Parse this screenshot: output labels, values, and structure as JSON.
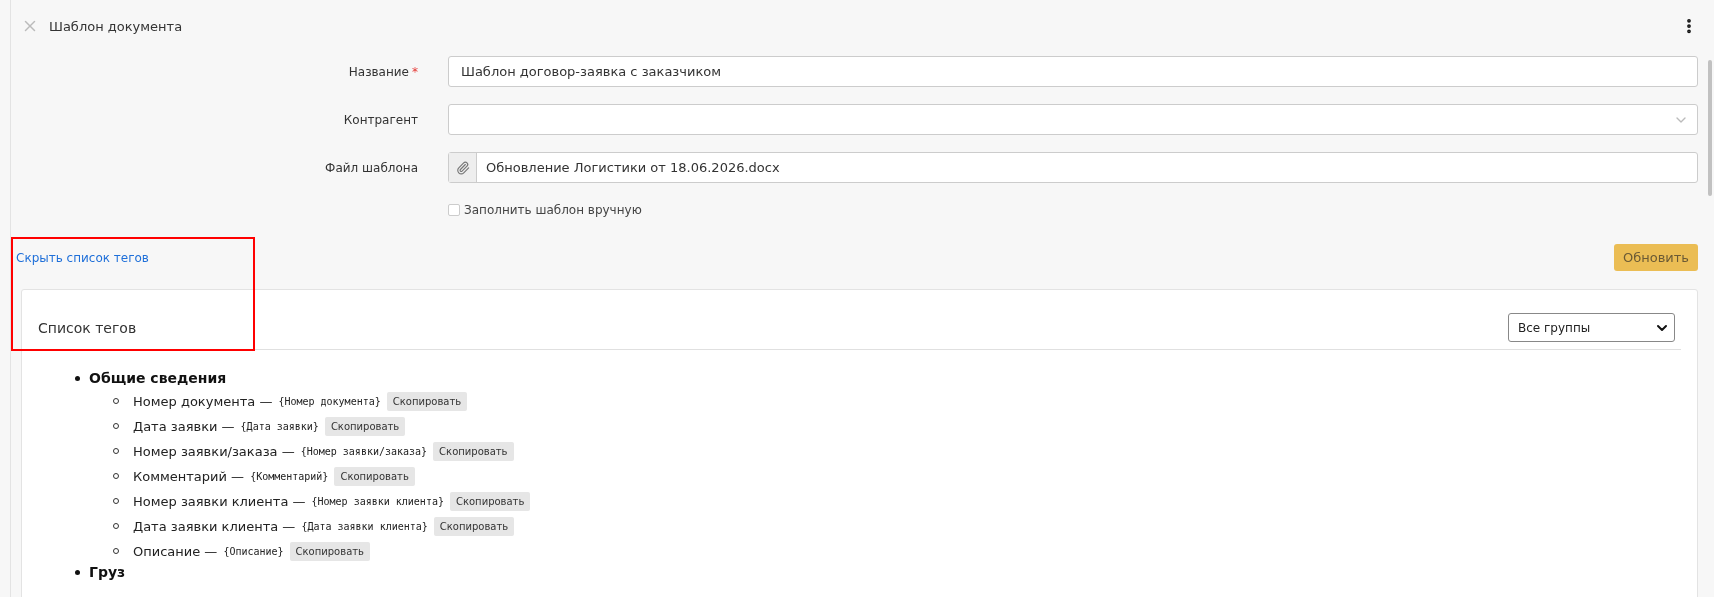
{
  "header": {
    "title": "Шаблон документа"
  },
  "form": {
    "fields": [
      {
        "kind": "text",
        "label": "Название",
        "required_mark": "*",
        "value": "Шаблон договор-заявка с заказчиком"
      },
      {
        "kind": "select",
        "label": "Контрагент"
      },
      {
        "kind": "file",
        "label": "Файл шаблона",
        "value": "Обновление Логистики от 18.06.2026.docx"
      }
    ],
    "manual_fill": {
      "label": "Заполнить шаблон вручную",
      "checked": false
    }
  },
  "toggle_link": "Скрыть список тегов",
  "update_button": {
    "label": "Обновить"
  },
  "tags_panel": {
    "title": "Список тегов",
    "group_select": "Все группы",
    "groups": [
      {
        "name": "Общие сведения",
        "tags": [
          {
            "label": "Номер документа —",
            "tag": "{Номер документа}",
            "copy": "Скопировать"
          },
          {
            "label": "Дата заявки —",
            "tag": "{Дата заявки}",
            "copy": "Скопировать"
          },
          {
            "label": "Номер заявки/заказа —",
            "tag": "{Номер заявки/заказа}",
            "copy": "Скопировать"
          },
          {
            "label": "Комментарий —",
            "tag": "{Комментарий}",
            "copy": "Скопировать"
          },
          {
            "label": "Номер заявки клиента —",
            "tag": "{Номер заявки клиента}",
            "copy": "Скопировать"
          },
          {
            "label": "Дата заявки клиента —",
            "tag": "{Дата заявки клиента}",
            "copy": "Скопировать"
          },
          {
            "label": "Описание —",
            "tag": "{Описание}",
            "copy": "Скопировать"
          }
        ]
      },
      {
        "name": "Груз"
      }
    ]
  }
}
